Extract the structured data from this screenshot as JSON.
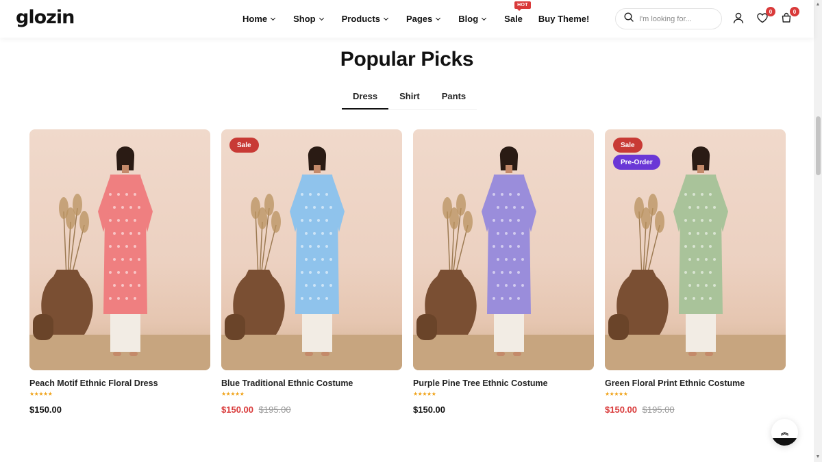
{
  "header": {
    "logo": "glozin",
    "nav": [
      {
        "label": "Home",
        "dropdown": true
      },
      {
        "label": "Shop",
        "dropdown": true
      },
      {
        "label": "Products",
        "dropdown": true
      },
      {
        "label": "Pages",
        "dropdown": true
      },
      {
        "label": "Blog",
        "dropdown": true
      },
      {
        "label": "Sale",
        "dropdown": false,
        "badge": "HOT"
      },
      {
        "label": "Buy Theme!",
        "dropdown": false
      }
    ],
    "search_placeholder": "I'm looking for...",
    "wishlist_count": "0",
    "cart_count": "0"
  },
  "section": {
    "title": "Popular Picks",
    "tabs": [
      {
        "label": "Dress",
        "active": true
      },
      {
        "label": "Shirt",
        "active": false
      },
      {
        "label": "Pants",
        "active": false
      }
    ]
  },
  "products": [
    {
      "name": "Peach Motif Ethnic Floral Dress",
      "stars": "★★★★★",
      "rating": 5,
      "price": "$150.00",
      "compare_price": "",
      "badges": [],
      "dress_color": "#ef7f80"
    },
    {
      "name": "Blue Traditional Ethnic Costume",
      "stars": "★★★★★",
      "rating": 5,
      "price": "$150.00",
      "compare_price": "$195.00",
      "badges": [
        "Sale"
      ],
      "dress_color": "#8fc3ec"
    },
    {
      "name": "Purple Pine Tree Ethnic Costume",
      "stars": "★★★★★",
      "rating": 5,
      "price": "$150.00",
      "compare_price": "",
      "badges": [],
      "dress_color": "#9a8ddb"
    },
    {
      "name": "Green Floral Print Ethnic Costume",
      "stars": "★★★★★",
      "rating": 5,
      "price": "$150.00",
      "compare_price": "$195.00",
      "badges": [
        "Sale",
        "Pre-Order"
      ],
      "dress_color": "#a9c39a"
    }
  ],
  "colors": {
    "accent_red": "#d93a3a",
    "preorder_purple": "#6a37d6",
    "text": "#111111"
  }
}
